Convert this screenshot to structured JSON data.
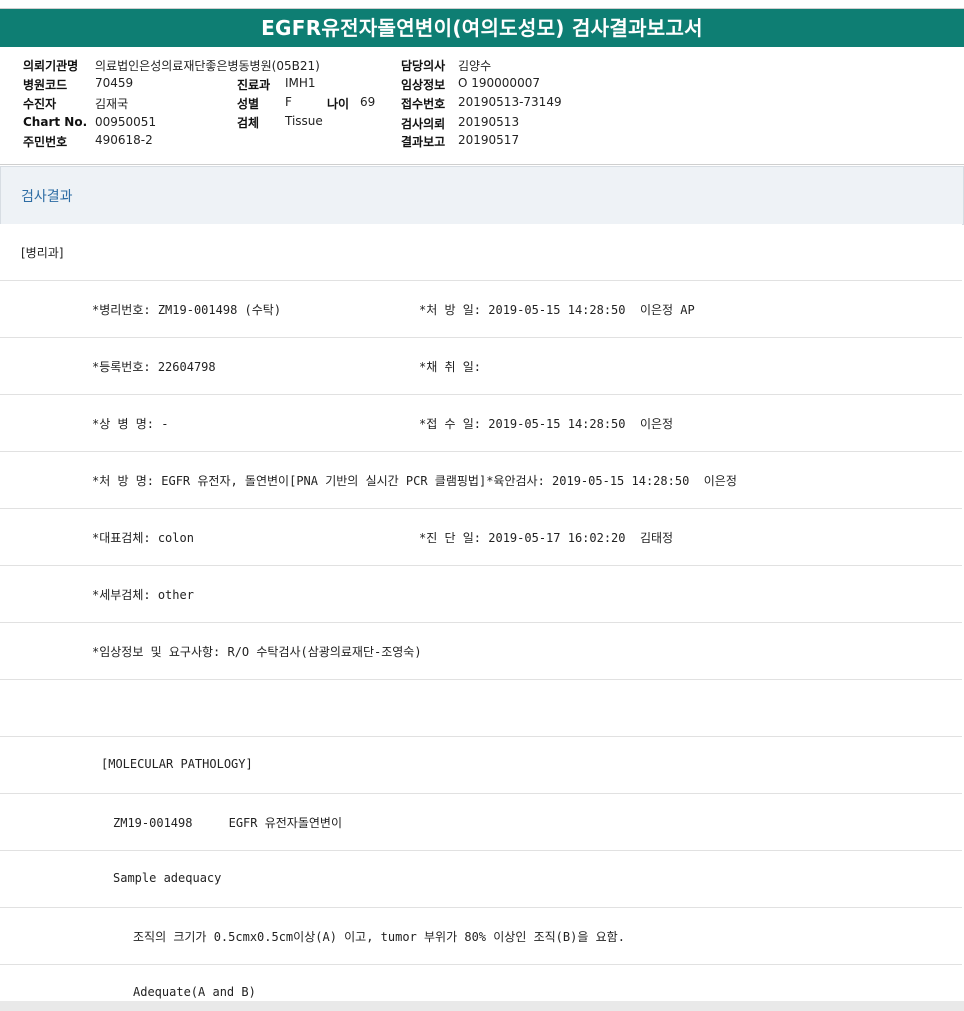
{
  "title": "EGFR유전자돌연변이(여의도성모) 검사결과보고서",
  "info": {
    "institution_label": "의뢰기관명",
    "institution_value": "의료법인은성의료재단좋은병동병원(05B21)",
    "hospital_code_label": "병원코드",
    "hospital_code_value": "70459",
    "patient_label": "수진자",
    "patient_value": "김재국",
    "chart_label": "Chart No.",
    "chart_value": "00950051",
    "resident_label": "주민번호",
    "resident_value": "490618-2",
    "dept_label": "진료과",
    "dept_value": "IMH1",
    "sex_label": "성별",
    "sex_value": "F",
    "age_label": "나이",
    "age_value": "69",
    "specimen_label": "검체",
    "specimen_value": "Tissue",
    "doctor_label": "담당의사",
    "doctor_value": "김양수",
    "clinical_label": "임상정보",
    "clinical_value": "O 190000007",
    "receipt_label": "접수번호",
    "receipt_value": "20190513-73149",
    "request_label": "검사의뢰",
    "request_value": "20190513",
    "report_label": "결과보고",
    "report_value": "20190517"
  },
  "section_title": "검사결과",
  "rows": {
    "dept": "[병리과]",
    "r1a": "*병리번호: ZM19-001498 (수탁)",
    "r1b": "*처 방 일: 2019-05-15 14:28:50  이은정 AP",
    "r2a": "*등록번호: 22604798",
    "r2b": "*채 취 일:",
    "r3a": "*상 병 명: -",
    "r3b": "*접 수 일: 2019-05-15 14:28:50  이은정",
    "r4": "*처 방 명: EGFR 유전자, 돌연변이[PNA 기반의 실시간 PCR 클램핑법]*육안검사: 2019-05-15 14:28:50  이은정",
    "r5a": "*대표검체: colon",
    "r5b": "*진 단 일: 2019-05-17 16:02:20  김태정",
    "r6": "*세부검체: other",
    "r7": "*임상정보 및 요구사항: R/O 수탁검사(삼광의료재단-조영숙)",
    "r8": "",
    "r9": "[MOLECULAR PATHOLOGY]",
    "r10": "ZM19-001498     EGFR 유전자돌연변이",
    "r11": "Sample adequacy",
    "r12": "조직의 크기가 0.5cmx0.5cm이상(A) 이고, tumor 부위가 80% 이상인 조직(B)을 요함.",
    "r13": "Adequate(A and B)"
  }
}
